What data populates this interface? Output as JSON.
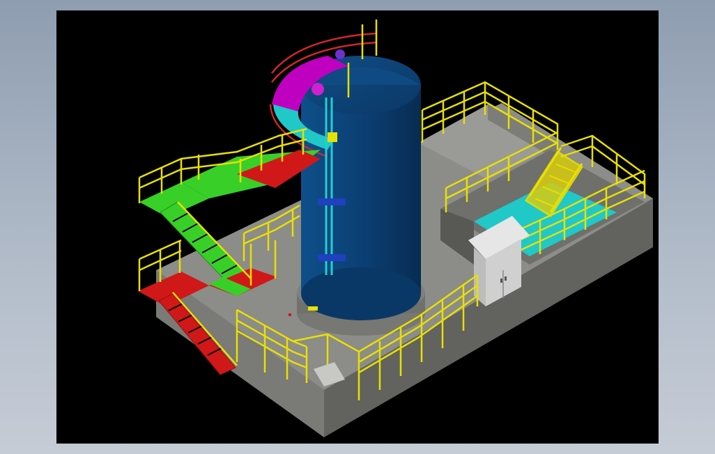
{
  "window": {
    "background_top": "#8e9db0",
    "background_bottom": "#c6ccd6"
  },
  "viewport": {
    "background": "#000000",
    "view": "isometric-3d-cad-model"
  },
  "model": {
    "tank_color": "#0b3e72",
    "railing_color": "#e8e000",
    "platform_red": "#d01818",
    "platform_green": "#38d028",
    "floor_cyan": "#20c8c8",
    "ring_magenta": "#c000c0",
    "concrete": "#8a8a86"
  }
}
